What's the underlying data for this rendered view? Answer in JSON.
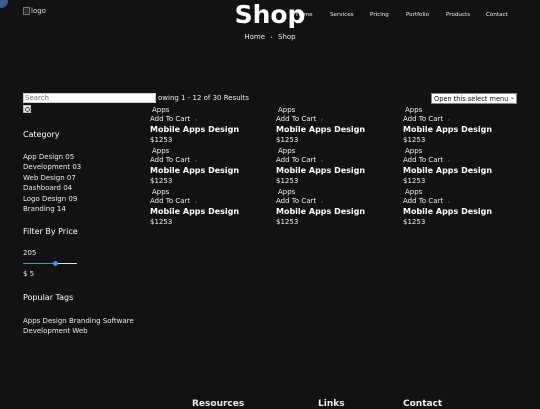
{
  "header": {
    "logo_alt": "logo",
    "nav": [
      "Home",
      "Services",
      "Pricing",
      "Portfolio",
      "Products",
      "Contact"
    ]
  },
  "hero": {
    "title": "Shop",
    "breadcrumb": [
      "Home",
      "Shop"
    ]
  },
  "sidebar": {
    "search_placeholder": "Search",
    "category_heading": "Category",
    "categories": [
      "App Design 05",
      "Development 03",
      "Web Design 07",
      "Dashboard 04",
      "Logo Design 09",
      "Branding 14"
    ],
    "price_heading": "Filter By Price",
    "price_max": "205",
    "price_level": 0.6,
    "price_range": "$ 5",
    "tags_heading": "Popular Tags",
    "tags": "Apps Design Branding Software Development Web"
  },
  "toolbar": {
    "results": "owing 1 - 12 of 30 Results",
    "sort_select": "Open this select menu"
  },
  "products": [
    {
      "category": "Apps",
      "cart": "Add To Cart",
      "title": "Mobile Apps Design",
      "price": "$1253"
    },
    {
      "category": "Apps",
      "cart": "Add To Cart",
      "title": "Mobile Apps Design",
      "price": "$1253"
    },
    {
      "category": "Apps",
      "cart": "Add To Cart",
      "title": "Mobile Apps Design",
      "price": "$1253"
    },
    {
      "category": "Apps",
      "cart": "Add To Cart",
      "title": "Mobile Apps Design",
      "price": "$1253"
    },
    {
      "category": "Apps",
      "cart": "Add To Cart",
      "title": "Mobile Apps Design",
      "price": "$1253"
    },
    {
      "category": "Apps",
      "cart": "Add To Cart",
      "title": "Mobile Apps Design",
      "price": "$1253"
    },
    {
      "category": "Apps",
      "cart": "Add To Cart",
      "title": "Mobile Apps Design",
      "price": "$1253"
    },
    {
      "category": "Apps",
      "cart": "Add To Cart",
      "title": "Mobile Apps Design",
      "price": "$1253"
    },
    {
      "category": "Apps",
      "cart": "Add To Cart",
      "title": "Mobile Apps Design",
      "price": "$1253"
    }
  ],
  "footer": {
    "headings": [
      "Resources",
      "Links",
      "Contact"
    ]
  }
}
